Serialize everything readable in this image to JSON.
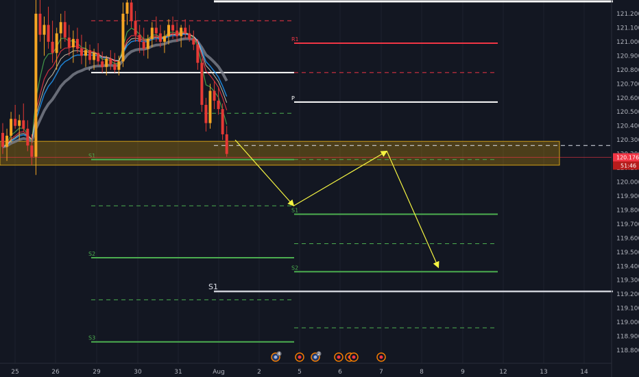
{
  "chart_data": {
    "type": "candlestick",
    "x_ticks": [
      "25",
      "26",
      "29",
      "30",
      "31",
      "Aug",
      "2",
      "5",
      "6",
      "7",
      "8",
      "9",
      "12",
      "13",
      "14"
    ],
    "y_ticks": [
      "121.200",
      "121.100",
      "121.000",
      "120.900",
      "120.800",
      "120.700",
      "120.600",
      "120.500",
      "120.400",
      "120.300",
      "120.200",
      "120.100",
      "120.000",
      "119.900",
      "119.800",
      "119.700",
      "119.600",
      "119.500",
      "119.400",
      "119.300",
      "119.200",
      "119.100",
      "119.000",
      "118.900",
      "118.800"
    ],
    "ylim": [
      118.75,
      121.26
    ],
    "last_price": {
      "label": "120.176",
      "value": 120.176,
      "color": "#f23645"
    },
    "countdown": {
      "label": "51:46"
    },
    "zone": {
      "low": 120.12,
      "high": 120.29,
      "color": "#b8860b"
    },
    "weekly_pivots": [
      {
        "label": "R1",
        "value": 120.99,
        "color": "#f23645",
        "style": "solid"
      },
      {
        "label": "",
        "value": 120.78,
        "color": "#f23645",
        "style": "dashed"
      },
      {
        "label": "P",
        "value": 120.57,
        "color": "#ffffff",
        "style": "solid"
      },
      {
        "label": "",
        "value": 120.16,
        "color": "#4caf50",
        "style": "dashed"
      },
      {
        "label": "S1",
        "value": 119.77,
        "color": "#4caf50",
        "style": "solid"
      },
      {
        "label": "",
        "value": 119.56,
        "color": "#4caf50",
        "style": "dashed"
      },
      {
        "label": "S2",
        "value": 119.36,
        "color": "#4caf50",
        "style": "solid"
      },
      {
        "label": "",
        "value": 118.96,
        "color": "#4caf50",
        "style": "dashed"
      }
    ],
    "prior_pivots": [
      {
        "label": "",
        "value": 121.15,
        "color": "#f23645",
        "style": "dashed"
      },
      {
        "label": "P",
        "value": 120.78,
        "color": "#ffffff",
        "style": "solid"
      },
      {
        "label": "",
        "value": 120.49,
        "color": "#4caf50",
        "style": "dashed"
      },
      {
        "label": "S1",
        "value": 120.16,
        "color": "#4caf50",
        "style": "solid"
      },
      {
        "label": "",
        "value": 119.83,
        "color": "#4caf50",
        "style": "dashed"
      },
      {
        "label": "S2",
        "value": 119.46,
        "color": "#4caf50",
        "style": "solid"
      },
      {
        "label": "",
        "value": 119.16,
        "color": "#4caf50",
        "style": "dashed"
      },
      {
        "label": "S3",
        "value": 118.86,
        "color": "#4caf50",
        "style": "solid"
      }
    ],
    "monthly_levels": [
      {
        "label": "",
        "value": 121.27,
        "color": "#ffffff"
      },
      {
        "label": "S1",
        "value": 119.22,
        "color": "#cfd2d9"
      }
    ],
    "dashed_white_level": 120.26,
    "forecast_path": [
      {
        "x": 0.0,
        "y": 120.3
      },
      {
        "x": 1.44,
        "y": 119.83
      },
      {
        "x": 3.73,
        "y": 120.22
      },
      {
        "x": 5.0,
        "y": 119.39
      }
    ],
    "event_markers": [
      "4",
      "",
      "2",
      "",
      "",
      "",
      ""
    ],
    "candles": [
      [
        120.35,
        120.42,
        120.2,
        120.25
      ],
      [
        120.25,
        120.38,
        120.15,
        120.33
      ],
      [
        120.33,
        120.5,
        120.28,
        120.45
      ],
      [
        120.45,
        120.55,
        120.38,
        120.4
      ],
      [
        120.4,
        120.48,
        120.3,
        120.44
      ],
      [
        120.44,
        120.56,
        120.36,
        120.38
      ],
      [
        120.38,
        120.44,
        120.22,
        120.26
      ],
      [
        120.26,
        120.34,
        120.12,
        120.18
      ],
      [
        120.18,
        121.3,
        120.05,
        121.2
      ],
      [
        121.2,
        121.35,
        121.0,
        121.05
      ],
      [
        121.05,
        121.18,
        120.9,
        121.12
      ],
      [
        121.12,
        121.25,
        120.95,
        121.0
      ],
      [
        121.0,
        121.15,
        120.85,
        120.92
      ],
      [
        120.92,
        121.1,
        120.8,
        121.06
      ],
      [
        121.06,
        121.2,
        120.95,
        121.14
      ],
      [
        121.14,
        121.22,
        121.0,
        121.03
      ],
      [
        121.03,
        121.12,
        120.9,
        120.96
      ],
      [
        120.96,
        121.08,
        120.85,
        121.02
      ],
      [
        121.02,
        121.1,
        120.92,
        120.95
      ],
      [
        120.95,
        121.05,
        120.84,
        120.9
      ],
      [
        120.9,
        121.0,
        120.82,
        120.94
      ],
      [
        120.94,
        120.98,
        120.84,
        120.87
      ],
      [
        120.87,
        120.95,
        120.8,
        120.92
      ],
      [
        120.92,
        120.99,
        120.83,
        120.86
      ],
      [
        120.86,
        120.93,
        120.78,
        120.82
      ],
      [
        120.82,
        120.9,
        120.76,
        120.88
      ],
      [
        120.88,
        120.94,
        120.8,
        120.84
      ],
      [
        120.84,
        120.92,
        120.78,
        120.8
      ],
      [
        120.8,
        120.9,
        120.76,
        120.86
      ],
      [
        120.86,
        121.28,
        120.82,
        121.2
      ],
      [
        121.2,
        121.35,
        121.12,
        121.28
      ],
      [
        121.28,
        121.33,
        121.1,
        121.15
      ],
      [
        121.15,
        121.22,
        121.0,
        121.05
      ],
      [
        121.05,
        121.12,
        120.92,
        121.0
      ],
      [
        121.0,
        121.1,
        120.9,
        120.95
      ],
      [
        120.95,
        121.05,
        120.88,
        121.02
      ],
      [
        121.02,
        121.14,
        120.96,
        121.1
      ],
      [
        121.1,
        121.18,
        121.0,
        121.06
      ],
      [
        121.06,
        121.12,
        120.96,
        121.0
      ],
      [
        121.0,
        121.08,
        120.92,
        121.04
      ],
      [
        121.04,
        121.16,
        120.98,
        121.12
      ],
      [
        121.12,
        121.18,
        121.02,
        121.08
      ],
      [
        121.08,
        121.14,
        121.0,
        121.04
      ],
      [
        121.04,
        121.12,
        120.96,
        121.1
      ],
      [
        121.1,
        121.16,
        121.02,
        121.06
      ],
      [
        121.06,
        121.12,
        121.0,
        121.02
      ],
      [
        121.02,
        121.08,
        120.94,
        120.98
      ],
      [
        120.98,
        121.02,
        120.8,
        120.85
      ],
      [
        120.85,
        120.88,
        120.5,
        120.55
      ],
      [
        120.55,
        120.6,
        120.36,
        120.42
      ],
      [
        120.42,
        120.7,
        120.38,
        120.65
      ],
      [
        120.65,
        120.72,
        120.52,
        120.58
      ],
      [
        120.58,
        120.68,
        120.48,
        120.52
      ],
      [
        120.52,
        120.56,
        120.3,
        120.34
      ],
      [
        120.34,
        120.4,
        120.18,
        120.2
      ]
    ]
  }
}
